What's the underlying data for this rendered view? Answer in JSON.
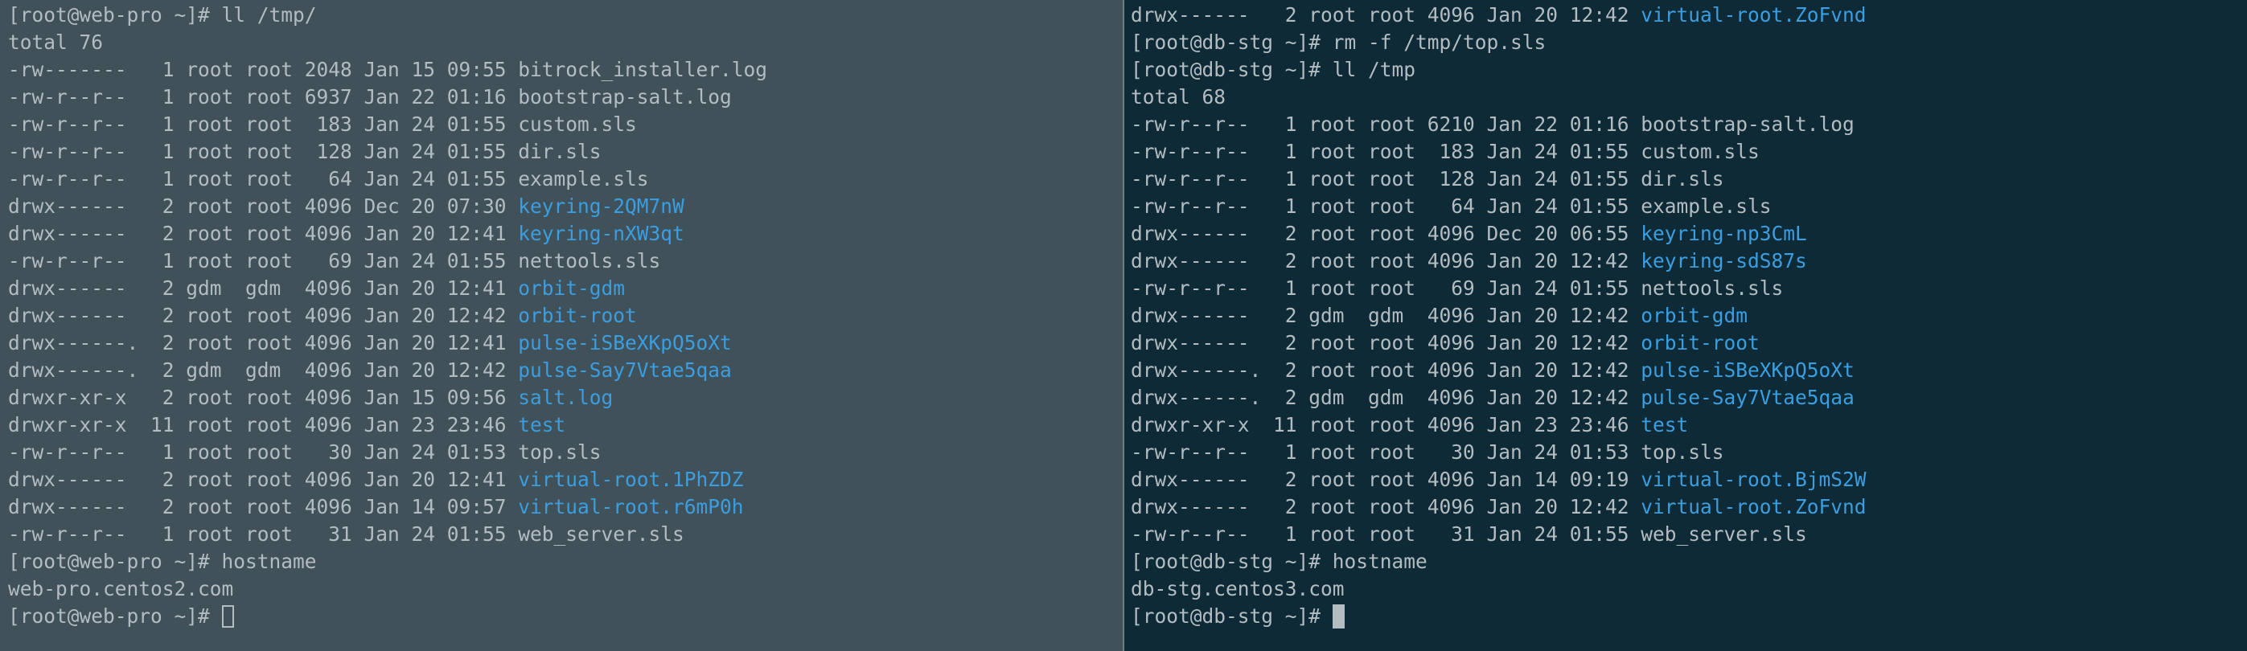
{
  "left_pane": {
    "lines": [
      {
        "text": "[root@web-pro ~]# ll /tmp/"
      },
      {
        "text": "total 76"
      },
      {
        "text": "-rw-------   1 root root 2048 Jan 15 09:55 ",
        "name": "bitrock_installer.log",
        "type": "file"
      },
      {
        "text": "-rw-r--r--   1 root root 6937 Jan 22 01:16 ",
        "name": "bootstrap-salt.log",
        "type": "file"
      },
      {
        "text": "-rw-r--r--   1 root root  183 Jan 24 01:55 ",
        "name": "custom.sls",
        "type": "file"
      },
      {
        "text": "-rw-r--r--   1 root root  128 Jan 24 01:55 ",
        "name": "dir.sls",
        "type": "file"
      },
      {
        "text": "-rw-r--r--   1 root root   64 Jan 24 01:55 ",
        "name": "example.sls",
        "type": "file"
      },
      {
        "text": "drwx------   2 root root 4096 Dec 20 07:30 ",
        "name": "keyring-2QM7nW",
        "type": "dir"
      },
      {
        "text": "drwx------   2 root root 4096 Jan 20 12:41 ",
        "name": "keyring-nXW3qt",
        "type": "dir"
      },
      {
        "text": "-rw-r--r--   1 root root   69 Jan 24 01:55 ",
        "name": "nettools.sls",
        "type": "file"
      },
      {
        "text": "drwx------   2 gdm  gdm  4096 Jan 20 12:41 ",
        "name": "orbit-gdm",
        "type": "dir"
      },
      {
        "text": "drwx------   2 root root 4096 Jan 20 12:42 ",
        "name": "orbit-root",
        "type": "dir"
      },
      {
        "text": "drwx------.  2 root root 4096 Jan 20 12:41 ",
        "name": "pulse-iSBeXKpQ5oXt",
        "type": "dir"
      },
      {
        "text": "drwx------.  2 gdm  gdm  4096 Jan 20 12:42 ",
        "name": "pulse-Say7Vtae5qaa",
        "type": "dir"
      },
      {
        "text": "drwxr-xr-x   2 root root 4096 Jan 15 09:56 ",
        "name": "salt.log",
        "type": "dir"
      },
      {
        "text": "drwxr-xr-x  11 root root 4096 Jan 23 23:46 ",
        "name": "test",
        "type": "dir"
      },
      {
        "text": "-rw-r--r--   1 root root   30 Jan 24 01:53 ",
        "name": "top.sls",
        "type": "file"
      },
      {
        "text": "drwx------   2 root root 4096 Jan 20 12:41 ",
        "name": "virtual-root.1PhZDZ",
        "type": "dir"
      },
      {
        "text": "drwx------   2 root root 4096 Jan 14 09:57 ",
        "name": "virtual-root.r6mP0h",
        "type": "dir"
      },
      {
        "text": "-rw-r--r--   1 root root   31 Jan 24 01:55 ",
        "name": "web_server.sls",
        "type": "file"
      },
      {
        "text": "[root@web-pro ~]# hostname"
      },
      {
        "text": "web-pro.centos2.com"
      },
      {
        "text": "[root@web-pro ~]# ",
        "cursor": "outline"
      }
    ]
  },
  "right_pane": {
    "lines": [
      {
        "text": "drwx------   2 root root 4096 Jan 20 12:42 ",
        "name": "virtual-root.ZoFvnd",
        "type": "dir"
      },
      {
        "text": "[root@db-stg ~]# rm -f /tmp/top.sls"
      },
      {
        "text": "[root@db-stg ~]# ll /tmp"
      },
      {
        "text": "total 68"
      },
      {
        "text": "-rw-r--r--   1 root root 6210 Jan 22 01:16 ",
        "name": "bootstrap-salt.log",
        "type": "file"
      },
      {
        "text": "-rw-r--r--   1 root root  183 Jan 24 01:55 ",
        "name": "custom.sls",
        "type": "file"
      },
      {
        "text": "-rw-r--r--   1 root root  128 Jan 24 01:55 ",
        "name": "dir.sls",
        "type": "file"
      },
      {
        "text": "-rw-r--r--   1 root root   64 Jan 24 01:55 ",
        "name": "example.sls",
        "type": "file"
      },
      {
        "text": "drwx------   2 root root 4096 Dec 20 06:55 ",
        "name": "keyring-np3CmL",
        "type": "dir"
      },
      {
        "text": "drwx------   2 root root 4096 Jan 20 12:42 ",
        "name": "keyring-sdS87s",
        "type": "dir"
      },
      {
        "text": "-rw-r--r--   1 root root   69 Jan 24 01:55 ",
        "name": "nettools.sls",
        "type": "file"
      },
      {
        "text": "drwx------   2 gdm  gdm  4096 Jan 20 12:42 ",
        "name": "orbit-gdm",
        "type": "dir"
      },
      {
        "text": "drwx------   2 root root 4096 Jan 20 12:42 ",
        "name": "orbit-root",
        "type": "dir"
      },
      {
        "text": "drwx------.  2 root root 4096 Jan 20 12:42 ",
        "name": "pulse-iSBeXKpQ5oXt",
        "type": "dir"
      },
      {
        "text": "drwx------.  2 gdm  gdm  4096 Jan 20 12:42 ",
        "name": "pulse-Say7Vtae5qaa",
        "type": "dir"
      },
      {
        "text": "drwxr-xr-x  11 root root 4096 Jan 23 23:46 ",
        "name": "test",
        "type": "dir"
      },
      {
        "text": "-rw-r--r--   1 root root   30 Jan 24 01:53 ",
        "name": "top.sls",
        "type": "file"
      },
      {
        "text": "drwx------   2 root root 4096 Jan 14 09:19 ",
        "name": "virtual-root.BjmS2W",
        "type": "dir"
      },
      {
        "text": "drwx------   2 root root 4096 Jan 20 12:42 ",
        "name": "virtual-root.ZoFvnd",
        "type": "dir"
      },
      {
        "text": "-rw-r--r--   1 root root   31 Jan 24 01:55 ",
        "name": "web_server.sls",
        "type": "file"
      },
      {
        "text": "[root@db-stg ~]# hostname"
      },
      {
        "text": "db-stg.centos3.com"
      },
      {
        "text": "[root@db-stg ~]# ",
        "cursor": "solid"
      }
    ]
  },
  "colors": {
    "left_background": "#40515a",
    "right_background": "#0e2a36",
    "text": "#b3bcc1",
    "directory": "#3a9ee0"
  }
}
